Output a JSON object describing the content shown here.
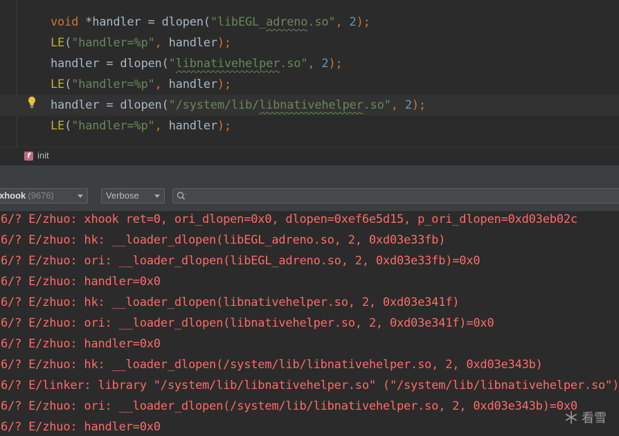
{
  "editor": {
    "lines": [
      {
        "parts": [
          {
            "t": "void",
            "c": "kw"
          },
          {
            "t": " *handler = dlopen(",
            "c": ""
          },
          {
            "t": "\"libEGL_",
            "c": "str"
          },
          {
            "t": "adreno",
            "c": "str sq"
          },
          {
            "t": ".so\"",
            "c": "str"
          },
          {
            "t": ", ",
            "c": "kw"
          },
          {
            "t": "2",
            "c": "num"
          },
          {
            "t": ");",
            "c": "kw"
          }
        ]
      },
      {
        "parts": [
          {
            "t": "LE",
            "c": "macro"
          },
          {
            "t": "(",
            "c": ""
          },
          {
            "t": "\"handler=%p\"",
            "c": "str"
          },
          {
            "t": ", ",
            "c": "kw"
          },
          {
            "t": "handler",
            "c": ""
          },
          {
            "t": ");",
            "c": "kw"
          }
        ]
      },
      {
        "parts": [
          {
            "t": "handler = dlopen(",
            "c": ""
          },
          {
            "t": "\"",
            "c": "str"
          },
          {
            "t": "libnativehelper",
            "c": "str sq"
          },
          {
            "t": ".so\"",
            "c": "str"
          },
          {
            "t": ", ",
            "c": "kw"
          },
          {
            "t": "2",
            "c": "num"
          },
          {
            "t": ");",
            "c": "kw"
          }
        ]
      },
      {
        "parts": [
          {
            "t": "LE",
            "c": "macro"
          },
          {
            "t": "(",
            "c": ""
          },
          {
            "t": "\"handler=%p\"",
            "c": "str"
          },
          {
            "t": ", ",
            "c": "kw"
          },
          {
            "t": "handler",
            "c": ""
          },
          {
            "t": ");",
            "c": "kw"
          }
        ]
      },
      {
        "current": true,
        "parts": [
          {
            "t": "handler = dlopen(",
            "c": ""
          },
          {
            "t": "\"/system/lib/",
            "c": "str"
          },
          {
            "t": "libnativehelper",
            "c": "str sq"
          },
          {
            "t": ".so\"",
            "c": "str"
          },
          {
            "t": ", ",
            "c": "kw"
          },
          {
            "t": "2",
            "c": "num"
          },
          {
            "t": ");",
            "c": "kw"
          }
        ]
      },
      {
        "parts": [
          {
            "t": "LE",
            "c": "macro"
          },
          {
            "t": "(",
            "c": ""
          },
          {
            "t": "\"handler=%p\"",
            "c": "str"
          },
          {
            "t": ", ",
            "c": "kw"
          },
          {
            "t": "handler",
            "c": ""
          },
          {
            "t": ");",
            "c": "kw"
          }
        ]
      }
    ]
  },
  "breadcrumb": {
    "badge": "f",
    "label": "init"
  },
  "toolbar": {
    "device_name": "xhook",
    "device_pid": "(9676)",
    "log_level": "Verbose",
    "search_icon": "search-icon"
  },
  "log": {
    "lines": [
      "6/? E/zhuo: xhook ret=0, ori_dlopen=0x0, dlopen=0xef6e5d15, p_ori_dlopen=0xd03eb02c",
      "6/? E/zhuo: hk: __loader_dlopen(libEGL_adreno.so, 2, 0xd03e33fb)",
      "6/? E/zhuo: ori: __loader_dlopen(libEGL_adreno.so, 2, 0xd03e33fb)=0x0",
      "6/? E/zhuo: handler=0x0",
      "6/? E/zhuo: hk: __loader_dlopen(libnativehelper.so, 2, 0xd03e341f)",
      "6/? E/zhuo: ori: __loader_dlopen(libnativehelper.so, 2, 0xd03e341f)=0x0",
      "6/? E/zhuo: handler=0x0",
      "6/? E/zhuo: hk: __loader_dlopen(/system/lib/libnativehelper.so, 2, 0xd03e343b)",
      "6/? E/linker: library \"/system/lib/libnativehelper.so\" (\"/system/lib/libnativehelper.so\")",
      "6/? E/zhuo: ori: __loader_dlopen(/system/lib/libnativehelper.so, 2, 0xd03e343b)=0x0",
      "6/? E/zhuo: handler=0x0"
    ]
  },
  "watermark": {
    "text": "看雪"
  },
  "colors": {
    "background": "#2b2b2b",
    "keyword": "#cc7832",
    "string": "#6a8759",
    "number": "#6897bb",
    "macro": "#bbb529",
    "log_error": "#ff6b68"
  }
}
